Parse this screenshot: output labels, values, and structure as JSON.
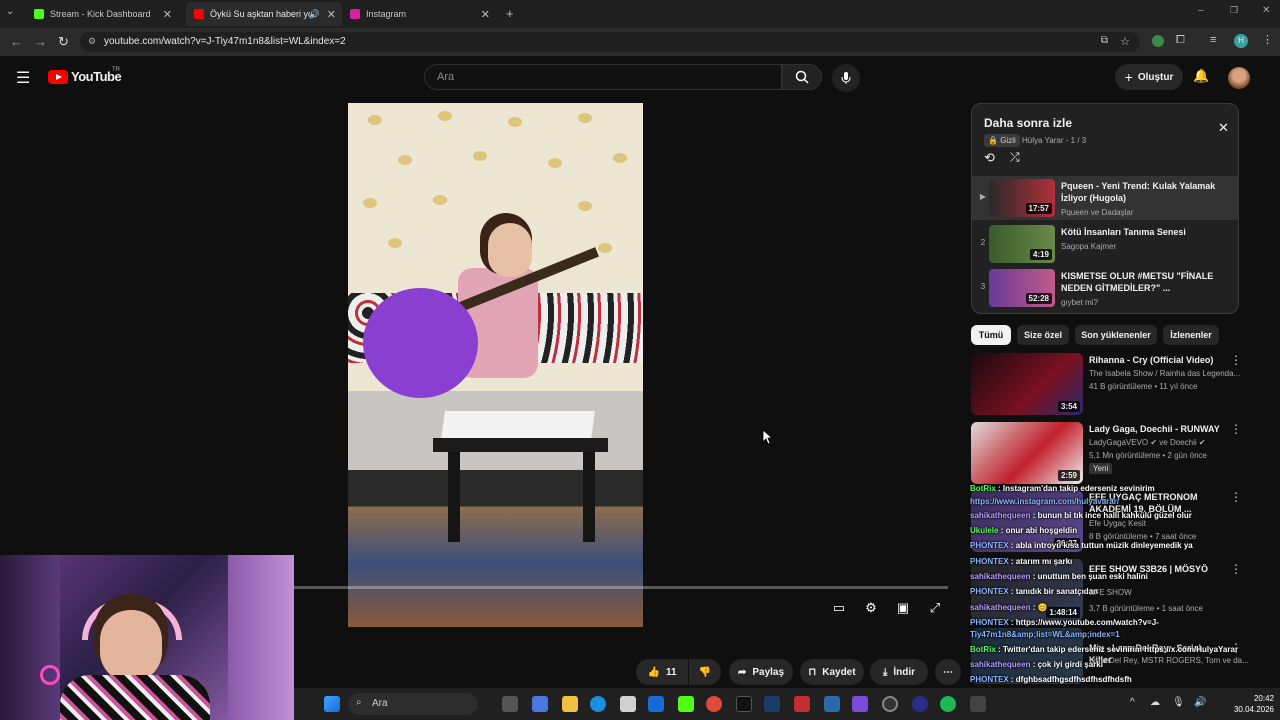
{
  "browser": {
    "tabs": [
      {
        "label": "Stream - Kick Dashboard",
        "icon": "kick-icon",
        "color": "#53fc18"
      },
      {
        "label": "Öykü Su aşktan haberi yok",
        "icon": "youtube-icon",
        "color": "#ff0000",
        "active": true
      },
      {
        "label": "Instagram",
        "icon": "instagram-icon",
        "color": "#d6249f"
      }
    ],
    "url": "youtube.com/watch?v=J-Tiy47m1n8&list=WL&index=2"
  },
  "youtube": {
    "logo_text": "YouTube",
    "region": "TR",
    "search_placeholder": "Ara",
    "create_label": "Oluştur"
  },
  "actions": {
    "likes": "11",
    "share": "Paylaş",
    "save": "Kaydet",
    "download": "İndir"
  },
  "playlist": {
    "title": "Daha sonra izle",
    "privacy": "Gizli",
    "owner": "Hülya Yarar - 1 / 3",
    "items": [
      {
        "index": "▶",
        "title": "Pqueen - Yeni Trend: Kulak Yalamak İzliyor (Hugola)",
        "channel": "Pqueen ve Dadaşlar",
        "duration": "17:57",
        "color": "#b0303a"
      },
      {
        "index": "2",
        "title": "Kötü İnsanları Tanıma Senesi",
        "channel": "Sagopa Kajmer",
        "duration": "4:19",
        "color": "#4a6a3a"
      },
      {
        "index": "3",
        "title": "KISMETSE OLUR #METSU \"FİNALE NEDEN GİTMEDİLER?\" ...",
        "channel": "gıybet mi?",
        "duration": "52:28",
        "color": "#6a3a9a"
      }
    ]
  },
  "chips": [
    "Tümü",
    "Size özel",
    "Son yüklenenler",
    "İzlenenler"
  ],
  "recommendations": [
    {
      "title": "Rihanna - Cry (Official Video)",
      "channel": "The Isabela Show / Rainha das Legenda...",
      "meta": "41 B görüntüleme • 11 yıl önce",
      "duration": "3:54",
      "color": "#7a1020"
    },
    {
      "title": "Lady Gaga, Doechii - RUNWAY",
      "channel": "LadyGagaVEVO ✔ ve Doechii ✔",
      "meta": "5,1 Mn görüntüleme • 2 gün önce",
      "badge": "Yeni",
      "duration": "2:59",
      "color": "#c0202a"
    },
    {
      "title": "EFE UYGAÇ METRONOM AKADEMİ 19. BÖLÜM ...",
      "channel": "Efe Uygaç Kesit",
      "meta": "8 B görüntüleme • 7 saat önce",
      "duration": "26:27",
      "color": "#5a4a8a"
    },
    {
      "title": "EFE SHOW S3B26 | MÖSYÖ",
      "channel": "EFE SHOW",
      "meta": "3,7 B görüntüleme • 1 saat önce",
      "duration": "1:48:14",
      "color": "#333a55"
    },
    {
      "title": "Mix - Lana Del Rey - Serial Killer",
      "channel": "Lana Del Rey, MSTR ROGERS, Tom ve da...",
      "meta": "",
      "duration": "",
      "color": "#2a3a4a"
    }
  ],
  "chat": [
    {
      "user": "BotRix",
      "text": " : Instagram'dan takip ederseniz sevinirim",
      "kind": "g"
    },
    {
      "user": "",
      "text": "https://www.instagram.com/hulyavarar/",
      "kind": "b"
    },
    {
      "user": "sahikathequeen",
      "text": " : bunun bi tık ince halli kahkülü güzel olur",
      "kind": ""
    },
    {
      "user": "Ukulele",
      "text": " : onur abi hoşgeldin",
      "kind": "g"
    },
    {
      "user": "PHONTEX",
      "text": " : abla introyu kısa tuttun müzik dinleyemedik ya",
      "kind": "b"
    },
    {
      "user": "PHONTEX",
      "text": " : atarım mı şarkı",
      "kind": "b"
    },
    {
      "user": "sahikathequeen",
      "text": " : unuttum ben şuan eski halini",
      "kind": ""
    },
    {
      "user": "PHONTEX",
      "text": " : tanıdık bir sanatçıdan",
      "kind": "b"
    },
    {
      "user": "sahikathequeen",
      "text": " : 😊",
      "kind": ""
    },
    {
      "user": "PHONTEX",
      "text": " : https://www.youtube.com/watch?v=J-",
      "kind": "b"
    },
    {
      "user": "",
      "text": "Tiy47m1n8&amp;list=WL&amp;index=1",
      "kind": "b"
    },
    {
      "user": "BotRix",
      "text": " : Twitter'dan takip ederseniz sevinirim https://x.com/HulyaYarar",
      "kind": "g"
    },
    {
      "user": "sahikathequeen",
      "text": " : çok iyi girdi şarkı",
      "kind": ""
    },
    {
      "user": "PHONTEX",
      "text": " : dfghbsadfhgsdfhsdfhsdfhdsfh",
      "kind": "b"
    },
    {
      "user": "PHONTEX",
      "text": " : 🦙",
      "kind": "b"
    },
    {
      "user": "PHONTEX",
      "text": " : 🦙",
      "kind": "b"
    }
  ],
  "taskbar": {
    "search_placeholder": "Ara",
    "time": "20:42",
    "date": "30.04.2026"
  }
}
